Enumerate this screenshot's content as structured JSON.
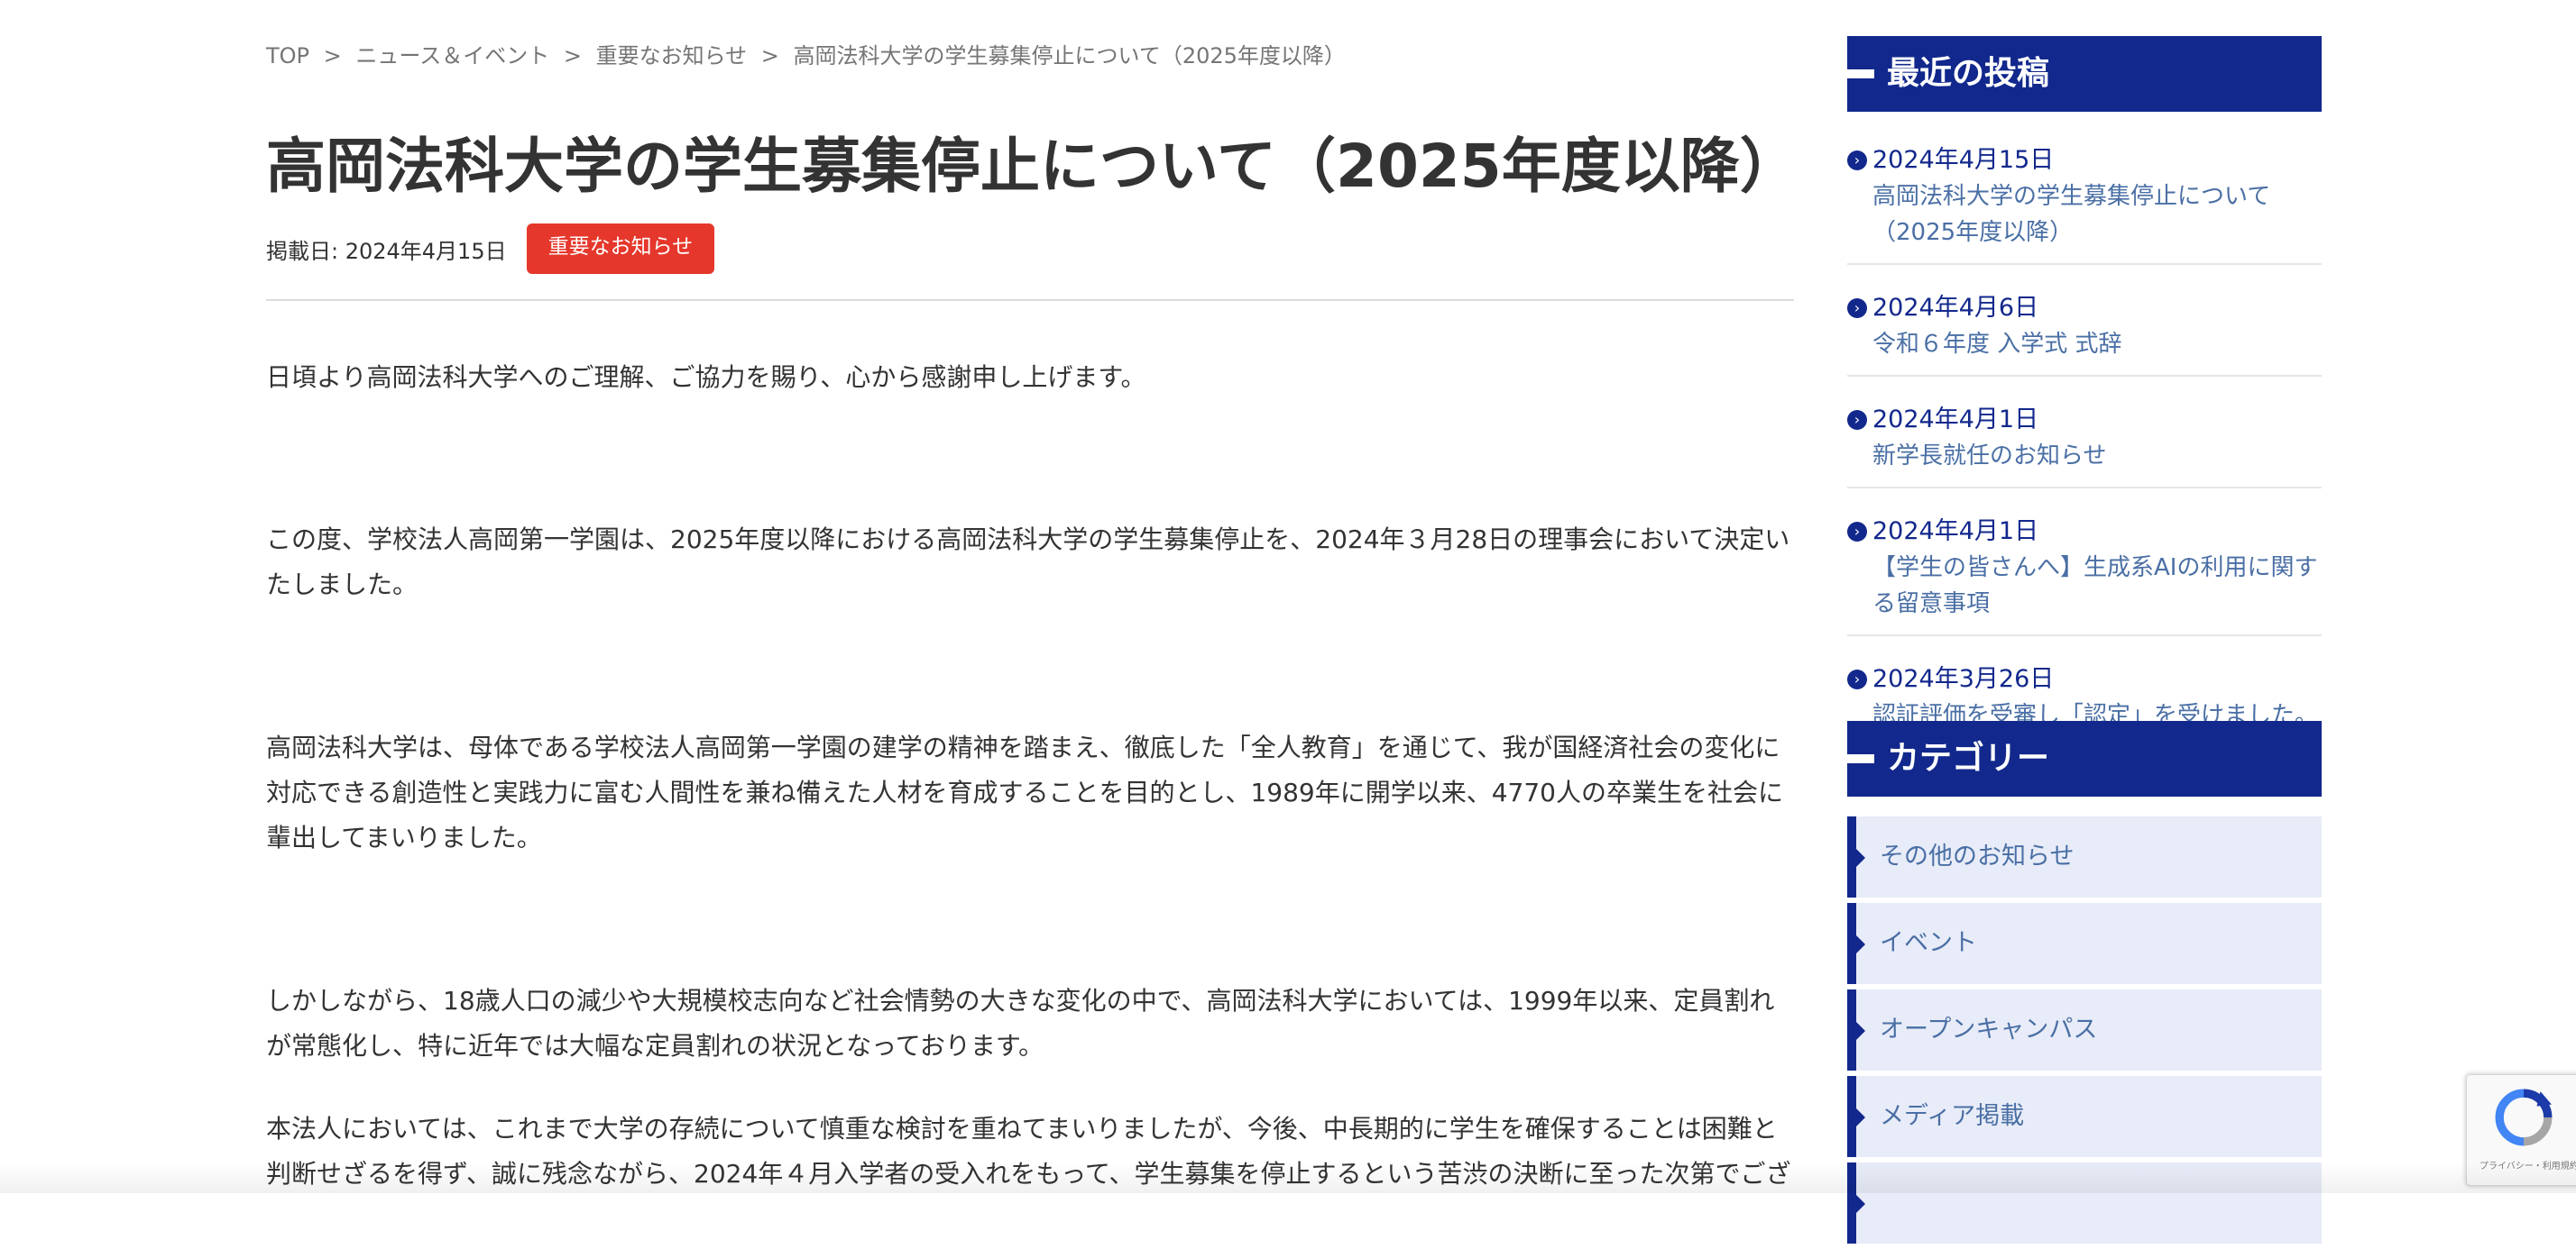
{
  "breadcrumb": {
    "items": [
      "TOP",
      "ニュース＆イベント",
      "重要なお知らせ",
      "高岡法科大学の学生募集停止について（2025年度以降）"
    ],
    "separator": ">"
  },
  "article": {
    "title": "高岡法科大学の学生募集停止について（2025年度以降）",
    "date_label": "掲載日: 2024年4月15日",
    "category_badge": "重要なお知らせ",
    "badge_color": "#e5372b",
    "paragraphs": [
      "日頃より高岡法科大学へのご理解、ご協力を賜り、心から感謝申し上げます。",
      "この度、学校法人高岡第一学園は、2025年度以降における高岡法科大学の学生募集停止を、2024年３月28日の理事会において決定いたしました。",
      "高岡法科大学は、母体である学校法人高岡第一学園の建学の精神を踏まえ、徹底した「全人教育」を通じて、我が国経済社会の変化に対応できる創造性と実践力に富む人間性を兼ね備えた人材を育成することを目的とし、1989年に開学以来、4770人の卒業生を社会に輩出してまいりました。",
      "しかしながら、18歳人口の減少や大規模校志向など社会情勢の大きな変化の中で、高岡法科大学においては、1999年以来、定員割れが常態化し、特に近年では大幅な定員割れの状況となっております。",
      "本法人においては、これまで大学の存続について慎重な検討を重ねてまいりましたが、今後、中長期的に学生を確保することは困難と判断せざるを得ず、誠に残念ながら、2024年４月入学者の受入れをもって、学生募集を停止するという苦渋の決断に至った次第でござ"
    ]
  },
  "sidebar": {
    "accent_color": "#12288c",
    "recent": {
      "title": "最近の投稿",
      "posts": [
        {
          "date": "2024年4月15日",
          "title": "高岡法科大学の学生募集停止について（2025年度以降）"
        },
        {
          "date": "2024年4月6日",
          "title": "令和６年度 入学式 式辞"
        },
        {
          "date": "2024年4月1日",
          "title": "新学長就任のお知らせ"
        },
        {
          "date": "2024年4月1日",
          "title": "【学生の皆さんへ】生成系AIの利用に関する留意事項"
        },
        {
          "date": "2024年3月26日",
          "title": "認証評価を受審し「認定」を受けました。"
        }
      ]
    },
    "categories": {
      "title": "カテゴリー",
      "items": [
        "その他のお知らせ",
        "イベント",
        "オープンキャンパス",
        "メディア掲載",
        ""
      ]
    }
  },
  "recaptcha": {
    "footer_text": "プライバシー・利用規約"
  },
  "icons": {
    "post_bullet": "chevron-right-circle-icon",
    "category_bullet": "triangle-right-icon"
  }
}
